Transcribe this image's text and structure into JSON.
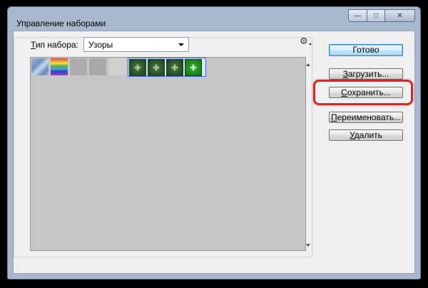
{
  "window": {
    "title": "Управление наборами",
    "controls": [
      "minimize-icon",
      "maximize-icon",
      "close-icon"
    ],
    "control_glyphs": {
      "min": "—",
      "max": "□",
      "close": "✕"
    }
  },
  "preset_type": {
    "label_underlined": "Т",
    "label_rest": "ип набора:",
    "value": "Узоры"
  },
  "menu_icon": {
    "icon": "gear-icon",
    "glyph": "⚙"
  },
  "patterns": {
    "items": [
      "pattern-blue-bubbles",
      "pattern-rainbow",
      "pattern-gray-noise",
      "pattern-gray-solid",
      "pattern-light-gray",
      "pattern-green-1",
      "pattern-green-2",
      "pattern-green-3",
      "pattern-green-4"
    ],
    "selected_count": 4,
    "tile_glyph": "✚"
  },
  "buttons": {
    "done": "Готово",
    "load_underlined": "З",
    "load_rest": "агрузить...",
    "save_underlined": "С",
    "save_rest": "охранить...",
    "rename_underlined": "П",
    "rename_rest": "ереименовать...",
    "delete_underlined": "У",
    "delete_rest": "далить"
  },
  "highlight_color": "#d8262b",
  "accent_color": "#3c7fb1"
}
